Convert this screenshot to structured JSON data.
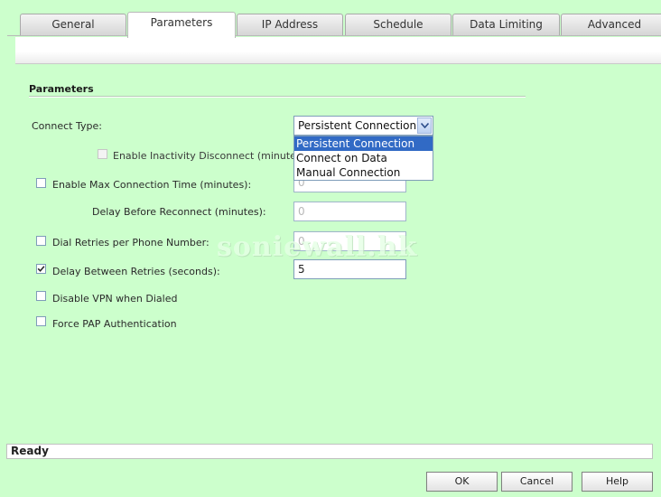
{
  "tabs": [
    {
      "label": "General"
    },
    {
      "label": "Parameters"
    },
    {
      "label": "IP Address"
    },
    {
      "label": "Schedule"
    },
    {
      "label": "Data Limiting"
    },
    {
      "label": "Advanced"
    }
  ],
  "active_tab": "Parameters",
  "section": {
    "title": "Parameters"
  },
  "connect_type": {
    "label": "Connect Type:",
    "selected": "Persistent Connection",
    "options": [
      "Persistent Connection",
      "Connect on Data",
      "Manual Connection"
    ]
  },
  "inactivity": {
    "label": "Enable Inactivity Disconnect (minutes):",
    "checked": false,
    "enabled": false
  },
  "max_conn_time": {
    "label": "Enable Max Connection Time (minutes):",
    "checked": false,
    "value": "0"
  },
  "delay_reconnect": {
    "label": "Delay Before Reconnect (minutes):",
    "value": "0"
  },
  "dial_retries": {
    "label": "Dial Retries per Phone Number:",
    "checked": false,
    "value": "0"
  },
  "delay_retries": {
    "label": "Delay Between Retries (seconds):",
    "checked": true,
    "value": "5"
  },
  "disable_vpn": {
    "label": "Disable VPN when Dialed",
    "checked": false
  },
  "force_pap": {
    "label": "Force PAP Authentication",
    "checked": false
  },
  "watermark": "soniewall.hk",
  "status": "Ready",
  "buttons": {
    "ok": "OK",
    "cancel": "Cancel",
    "help": "Help"
  }
}
